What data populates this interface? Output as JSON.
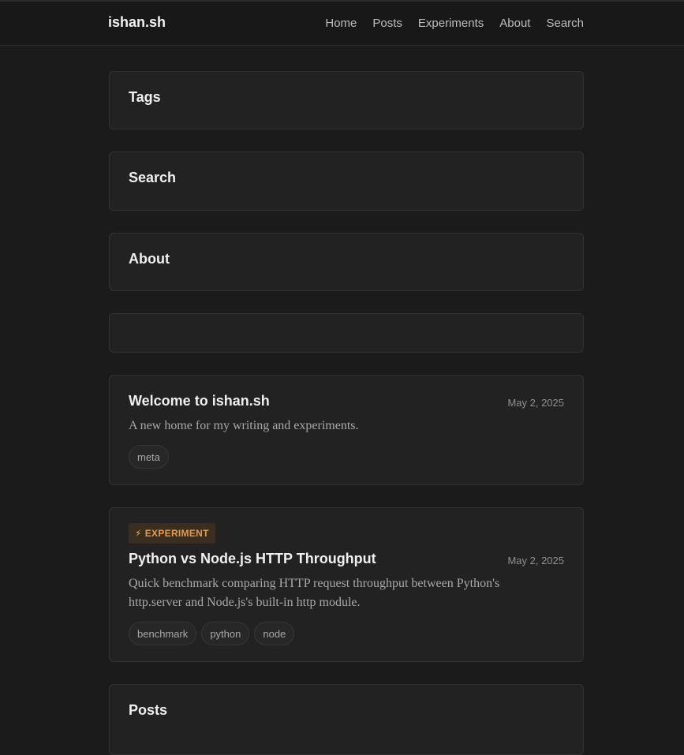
{
  "header": {
    "brand": "ishan.sh",
    "nav": [
      "Home",
      "Posts",
      "Experiments",
      "About",
      "Search"
    ]
  },
  "sections": {
    "tags_title": "Tags",
    "search_title": "Search",
    "about_title": "About",
    "posts_title": "Posts"
  },
  "posts": [
    {
      "title": "Welcome to ishan.sh",
      "date": "May 2, 2025",
      "description": "A new home for my writing and experiments.",
      "tags": [
        "meta"
      ]
    },
    {
      "badge": "EXPERIMENT",
      "badge_icon": "⚡",
      "title": "Python vs Node.js HTTP Throughput",
      "date": "May 2, 2025",
      "description": "Quick benchmark comparing HTTP request throughput between Python's http.server and Node.js's built-in http module.",
      "tags": [
        "benchmark",
        "python",
        "node"
      ]
    }
  ],
  "colors": {
    "background": "#1b1b1b",
    "card": "#222222",
    "badge_text": "#e69b44",
    "badge_bg": "#3a2e20"
  }
}
